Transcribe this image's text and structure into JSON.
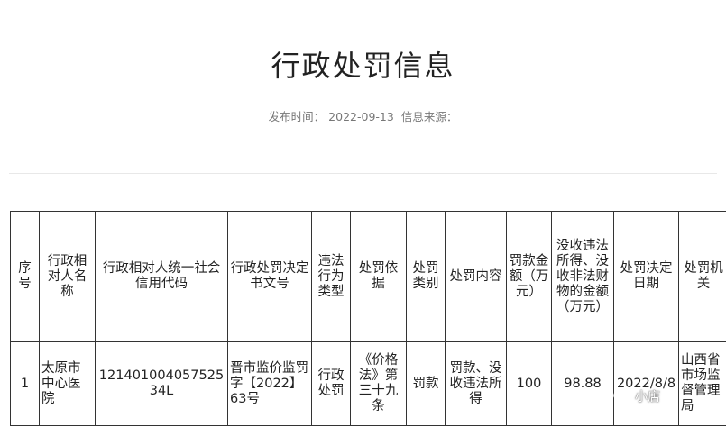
{
  "page": {
    "title": "行政处罚信息",
    "publish_label": "发布时间：",
    "publish_date": "2022-09-13",
    "source_label": "信息来源："
  },
  "table": {
    "headers": [
      "序号",
      "行政相对人名称",
      "行政相对人统一社会信用代码",
      "行政处罚决定书文号",
      "违法行为类型",
      "处罚依据",
      "处罚类别",
      "处罚内容",
      "罚款金额（万元）",
      "没收违法所得、没收非法财物的金额（万元）",
      "处罚决定日期",
      "处罚机关"
    ],
    "rows": [
      [
        "1",
        "太原市中心医院",
        "12140100405752534L",
        "晋市监价监罚字【2022】63号",
        "行政处罚",
        "《价格法》第三十九条",
        "罚款",
        "罚款、没收违法所得",
        "100",
        "98.88",
        "2022/8/8",
        "山西省市场监督管理局"
      ]
    ]
  },
  "watermark": {
    "text": "小店"
  }
}
